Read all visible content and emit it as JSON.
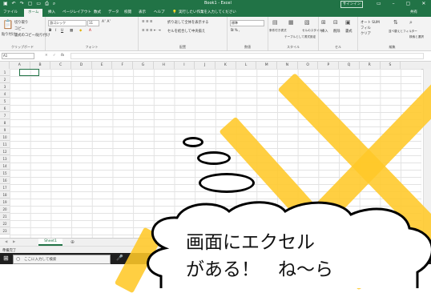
{
  "titlebar": {
    "doc_title": "Book1 - Excel",
    "signin_label": "サインイン",
    "qat_icons": [
      "save-icon",
      "undo-icon",
      "redo-icon",
      "new-icon",
      "open-icon",
      "print-icon",
      "preview-icon"
    ]
  },
  "tabs": [
    "ファイル",
    "ホーム",
    "挿入",
    "ページレイアウト",
    "数式",
    "データ",
    "校閲",
    "表示",
    "ヘルプ"
  ],
  "tellme": "実行したい作業を入力してください",
  "share_label": "共有",
  "ribbon": {
    "clipboard": {
      "paste": "貼り付け",
      "cut": "切り取り",
      "copy": "コピー",
      "format_painter": "書式のコピー/貼り付け",
      "label": "クリップボード"
    },
    "font": {
      "font_name": "游ゴシック",
      "font_size": "11",
      "label": "フォント"
    },
    "alignment": {
      "wrap": "折り返して全体を表示する",
      "merge": "セルを結合して中央揃え",
      "label": "配置"
    },
    "number": {
      "format": "標準",
      "label": "数値"
    },
    "styles": {
      "conditional": "条件付き書式",
      "table": "テーブルとして書式設定",
      "cell_styles": "セルのスタイル",
      "label": "スタイル"
    },
    "cells": {
      "insert": "挿入",
      "delete": "削除",
      "format": "書式",
      "label": "セル"
    },
    "editing": {
      "autosum": "オート SUM",
      "fill": "フィル",
      "clear": "クリア",
      "sort": "並べ替えとフィルター",
      "find": "検索と選択",
      "label": "編集"
    }
  },
  "formula_bar": {
    "name_box": "A1",
    "fx": "fx",
    "value": ""
  },
  "columns": [
    "A",
    "B",
    "C",
    "D",
    "E",
    "F",
    "G",
    "H",
    "I",
    "J",
    "K",
    "L",
    "M",
    "N",
    "O",
    "P",
    "Q",
    "R",
    "S"
  ],
  "rows": [
    "1",
    "2",
    "3",
    "4",
    "5",
    "6",
    "7",
    "8",
    "9",
    "10",
    "11",
    "12",
    "13",
    "14",
    "15",
    "16",
    "17",
    "18",
    "19",
    "20",
    "21",
    "22",
    "23"
  ],
  "sheet_tab": "Sheet1",
  "status": "準備完了",
  "taskbar": {
    "search_placeholder": "ここに入力して検索"
  },
  "overlay": {
    "line1": "画面にエクセル",
    "line2": "がある！　ね～ら"
  },
  "colors": {
    "excel_green": "#217346",
    "overlay_x": "#ffc828"
  }
}
